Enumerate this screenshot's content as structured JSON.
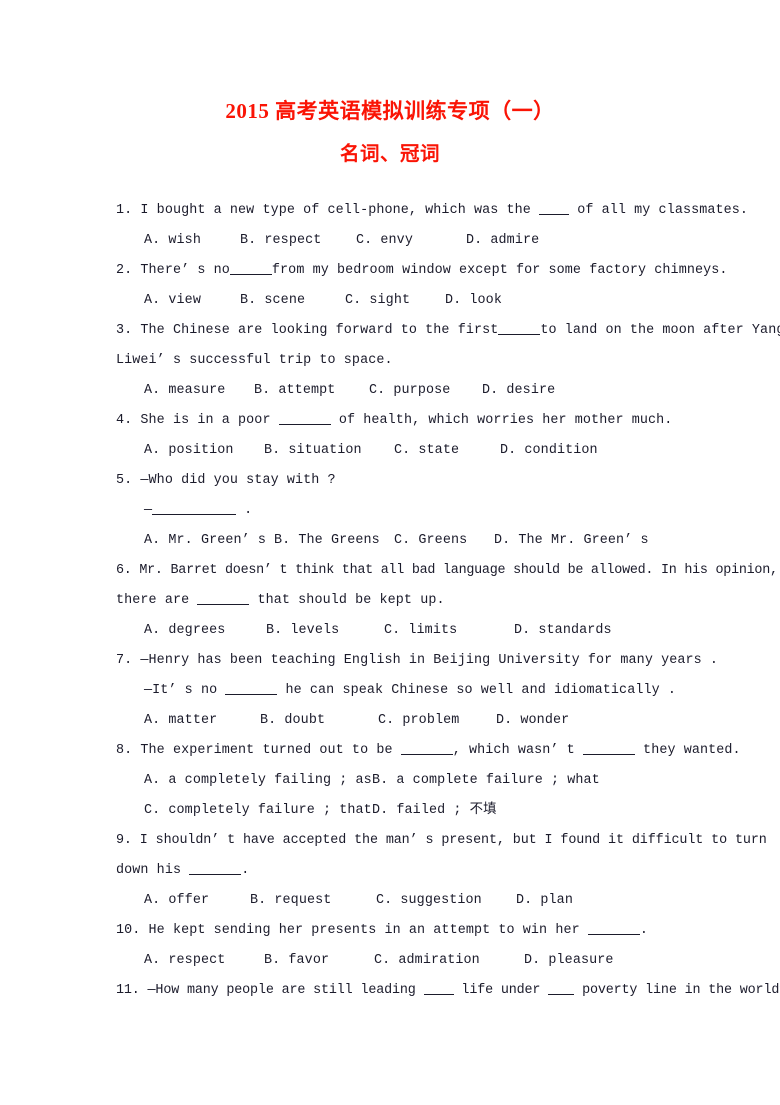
{
  "document": {
    "title": "2015 高考英语模拟训练专项（一）",
    "subtitle": "名词、冠词",
    "title_color": "#fa1405",
    "body_color": "#1b1b2b"
  },
  "questions": [
    {
      "number": "1.",
      "stem": "I bought a new type of cell-phone, which was the ____ of all my classmates.",
      "stem_pre": "1.  I bought a new type of cell-phone, which was the ",
      "stem_post": " of all my classmates.",
      "options": [
        "A. wish",
        "B. respect",
        "C. envy",
        "D. admire"
      ]
    },
    {
      "number": "2.",
      "stem_pre": "2. There’ s no",
      "stem_post": "from my bedroom window except for some factory chimneys.",
      "options": [
        "A. view",
        "B. scene",
        "C. sight",
        "D. look"
      ]
    },
    {
      "number": "3.",
      "stem_pre": "3. The Chinese are looking forward to the first",
      "stem_post": "to land on the moon after Yang",
      "stem_line2": "Liwei’ s successful trip to space.",
      "options": [
        "A. measure",
        "B. attempt",
        "C. purpose",
        "D. desire"
      ]
    },
    {
      "number": "4.",
      "stem_pre": "4.  She is in a poor ",
      "stem_post": " of health, which worries her mother much.",
      "options": [
        "A. position",
        "B. situation",
        "C. state",
        "D. condition"
      ]
    },
    {
      "number": "5.",
      "stem_line1": "5.  —Who did you stay with ?",
      "line2_pre": "—",
      "line2_post": " .",
      "options": [
        "A. Mr. Green’ s",
        "B. The Greens",
        "C. Greens",
        "D. The Mr. Green’ s"
      ]
    },
    {
      "number": "6.",
      "stem_line1": "6. Mr. Barret doesn’ t think that all bad language should be allowed. In his opinion,",
      "line2_pre": "there are ",
      "line2_post": " that should be kept up.",
      "options": [
        "A. degrees",
        "B. levels",
        "C. limits",
        "D. standards"
      ]
    },
    {
      "number": "7.",
      "stem_line1": "7.  —Henry has been teaching English in Beijing University for many years .",
      "line2_pre": "—It’ s no ",
      "line2_post": " he can speak Chinese so well and idiomatically .",
      "options": [
        "A. matter",
        "B. doubt",
        "C. problem",
        "D. wonder"
      ]
    },
    {
      "number": "8.",
      "stem_pre": "8.  The experiment turned out to be ",
      "stem_mid": ", which wasn’ t ",
      "stem_post": " they wanted.",
      "options_2col": [
        [
          "A. a completely failing ; as",
          "B. a complete failure ; what"
        ],
        [
          "C. completely failure ; that",
          "D. failed ; 不填"
        ]
      ]
    },
    {
      "number": "9.",
      "stem_line1": "9.  I shouldn’ t have accepted the man’ s present, but I found it difficult to turn",
      "line2_pre": "down his ",
      "line2_post": ".",
      "options": [
        "A. offer",
        "B. request",
        "C. suggestion",
        "D. plan"
      ]
    },
    {
      "number": "10.",
      "stem_pre": "10.  He kept sending her presents in an attempt to win her ",
      "stem_post": ".",
      "options": [
        "A. respect",
        "B. favor",
        "C. admiration",
        "D. pleasure"
      ]
    },
    {
      "number": "11.",
      "stem_pre": "11. —How many people are still leading ",
      "stem_mid": " life under ",
      "stem_post": " poverty line in the world?"
    }
  ]
}
